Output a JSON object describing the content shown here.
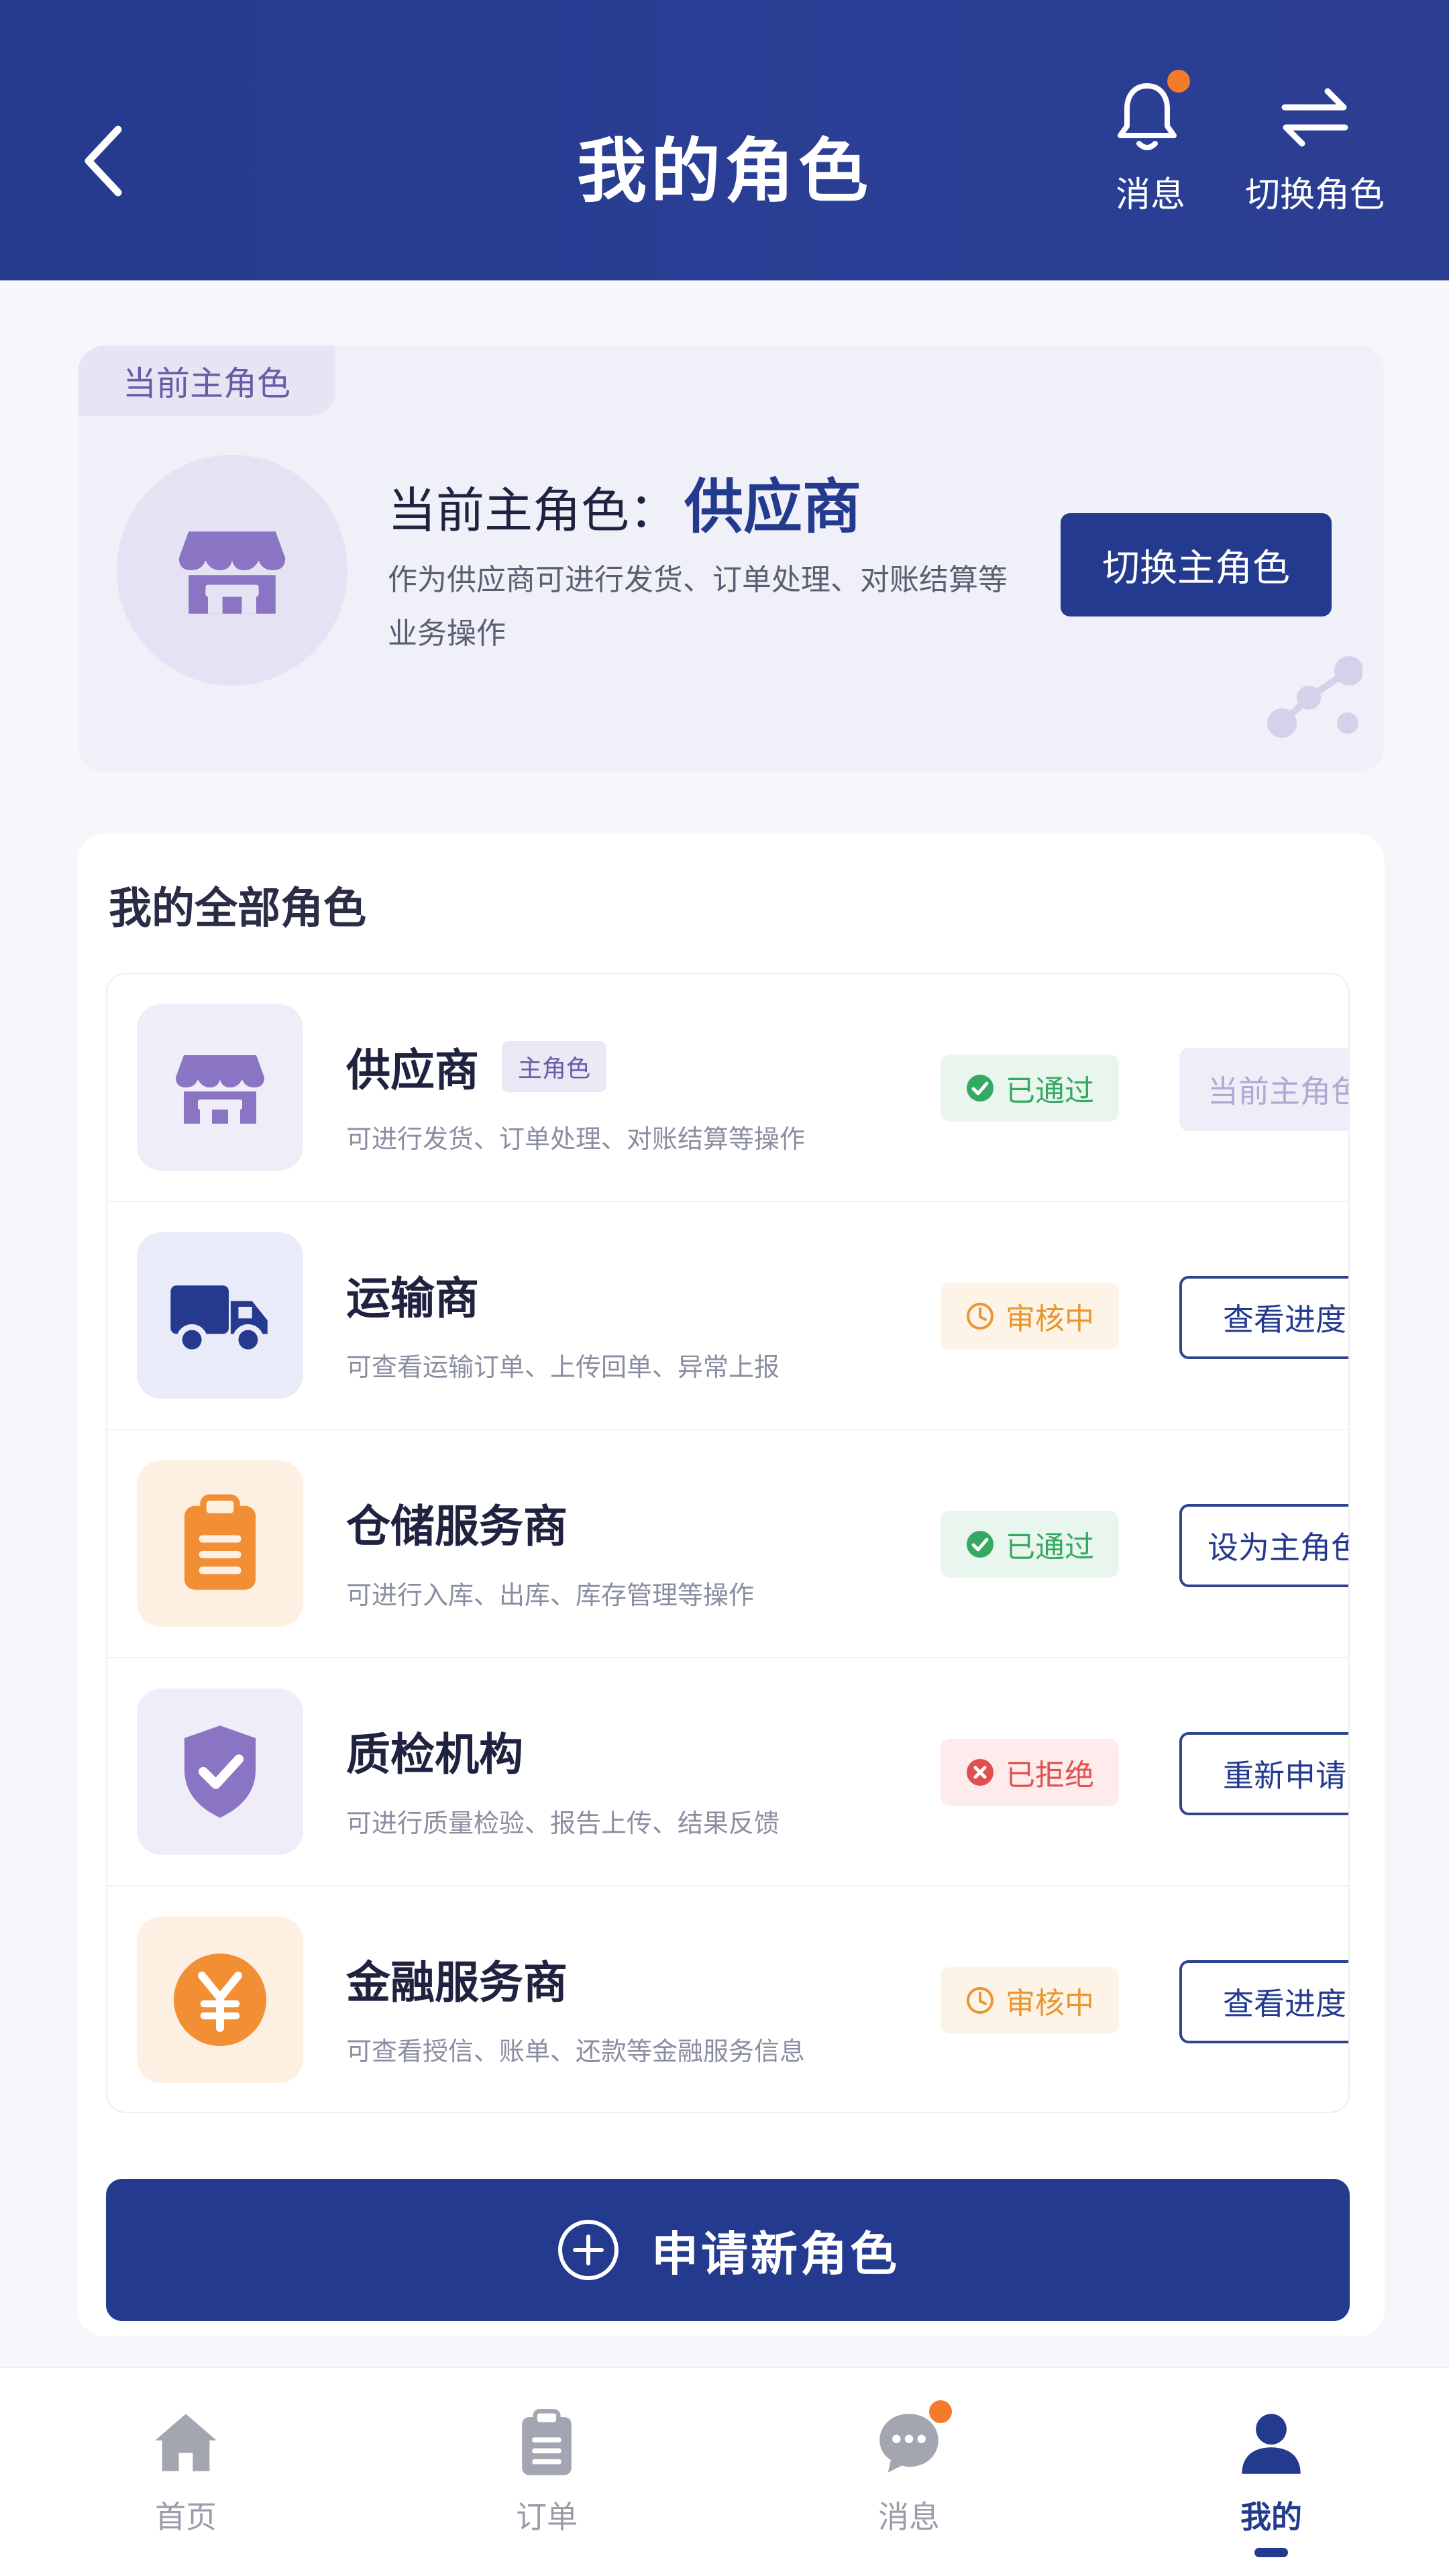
{
  "header": {
    "title": "我的角色",
    "message_label": "消息",
    "switch_label": "切换角色"
  },
  "current": {
    "tag": "当前主角色",
    "title_prefix": "当前主角色：",
    "role_name": "供应商",
    "description": "作为供应商可进行发货、订单处理、对账结算等业务操作",
    "switch_button": "切换主角色"
  },
  "roles_section": {
    "title": "我的全部角色",
    "items": [
      {
        "name": "供应商",
        "main_tag": "主角色",
        "desc": "可进行发货、订单处理、对账结算等操作",
        "status": "已通过",
        "action": "当前主角色",
        "icon": "store-icon"
      },
      {
        "name": "运输商",
        "desc": "可查看运输订单、上传回单、异常上报",
        "status": "审核中",
        "action": "查看进度",
        "icon": "truck-icon"
      },
      {
        "name": "仓储服务商",
        "desc": "可进行入库、出库、库存管理等操作",
        "status": "已通过",
        "action": "设为主角色",
        "icon": "clipboard-icon"
      },
      {
        "name": "质检机构",
        "desc": "可进行质量检验、报告上传、结果反馈",
        "status": "已拒绝",
        "action": "重新申请",
        "icon": "shield-check-icon"
      },
      {
        "name": "金融服务商",
        "desc": "可查看授信、账单、还款等金融服务信息",
        "status": "审核中",
        "action": "查看进度",
        "icon": "yen-icon"
      }
    ],
    "apply_button": "申请新角色"
  },
  "tabbar": {
    "items": [
      {
        "label": "首页",
        "icon": "home-icon"
      },
      {
        "label": "订单",
        "icon": "clipboard-icon"
      },
      {
        "label": "消息",
        "icon": "chat-icon"
      },
      {
        "label": "我的",
        "icon": "user-icon"
      }
    ],
    "active": 3
  },
  "colors": {
    "primary": "#233a8f",
    "approved": "#35a962",
    "pending": "#e8962f",
    "rejected": "#e05050",
    "badge": "#f47b2a"
  }
}
